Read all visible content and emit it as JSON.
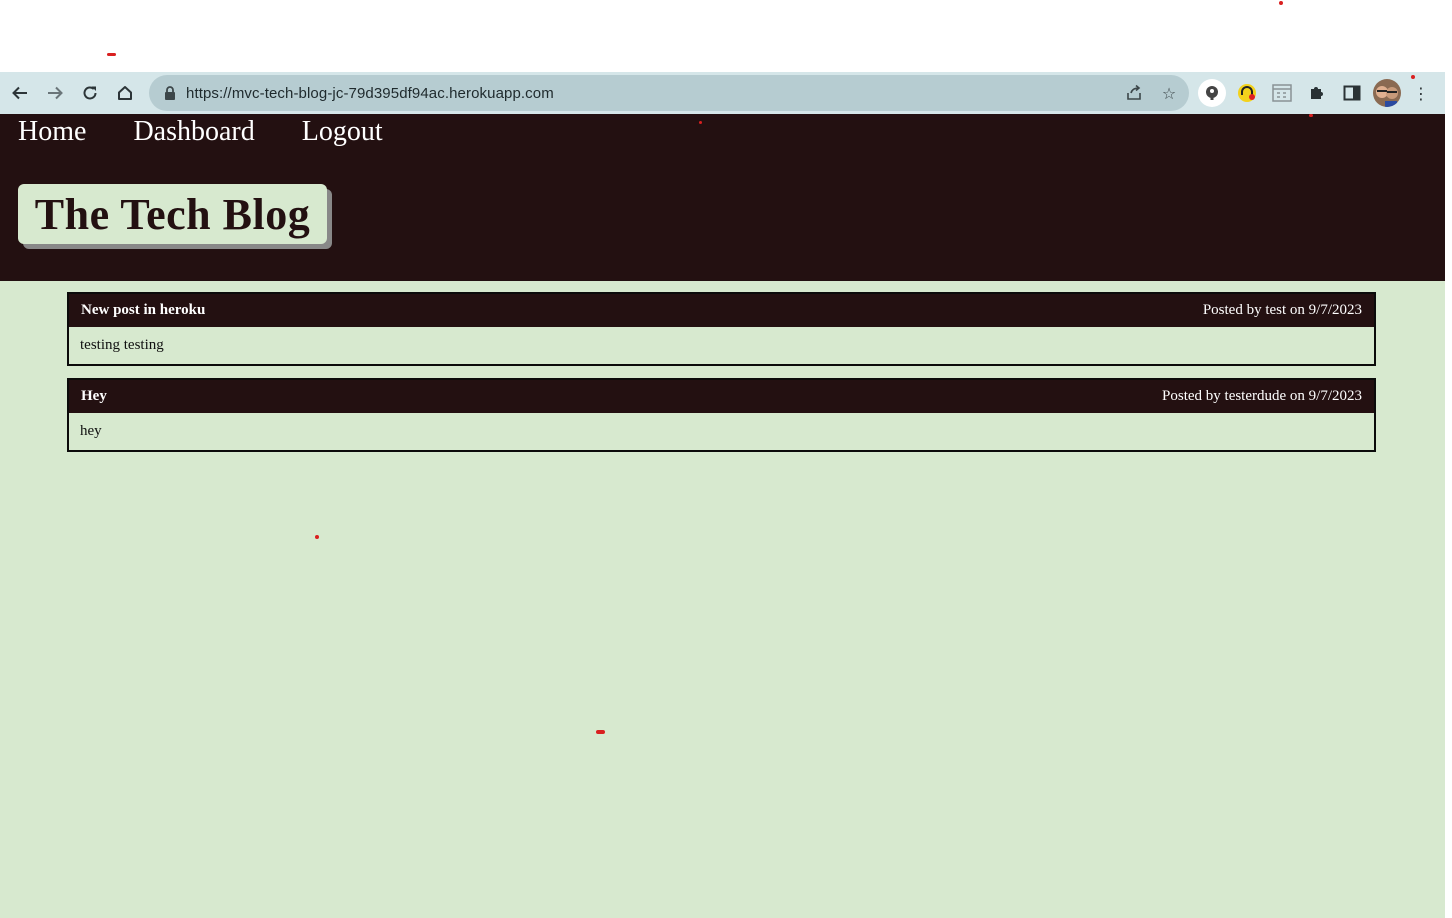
{
  "browser": {
    "url": "https://mvc-tech-blog-jc-79d395df94ac.herokuapp.com",
    "nav_icons": [
      "back-arrow-icon",
      "forward-arrow-icon",
      "reload-icon",
      "home-icon"
    ],
    "extensions": [
      "password-manager-icon",
      "audio-extension-icon",
      "calendar-extension-icon",
      "puzzle-extensions-icon",
      "side-panel-icon",
      "profile-avatar",
      "kebab-menu-icon"
    ]
  },
  "site": {
    "nav": [
      {
        "label": "Home"
      },
      {
        "label": "Dashboard"
      },
      {
        "label": "Logout"
      }
    ],
    "brand": "The Tech Blog"
  },
  "posts": [
    {
      "title": "New post in heroku",
      "meta": "Posted by test on 9/7/2023",
      "body": "testing testing"
    },
    {
      "title": "Hey",
      "meta": "Posted by testerdude on 9/7/2023",
      "body": "hey"
    }
  ],
  "colors": {
    "header_bg": "#231011",
    "page_bg": "#d7e9cf",
    "toolbar_bg": "#d5e6e9",
    "omnibox_bg": "#b6ccd1"
  }
}
